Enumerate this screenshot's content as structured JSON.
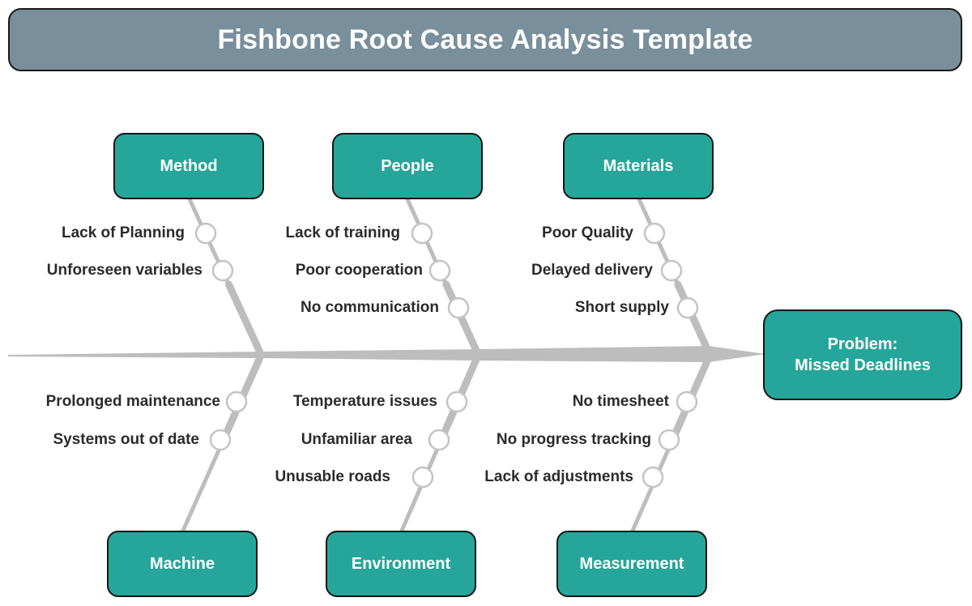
{
  "title": "Fishbone Root Cause Analysis Template",
  "problem": {
    "line1": "Problem:",
    "line2": "Missed Deadlines"
  },
  "colors": {
    "box": "#26a69a",
    "title_bar": "#798f9b",
    "bone": "#bdbdbd",
    "text": "#2b2b2b"
  },
  "categories": [
    {
      "name": "Method",
      "side": "top",
      "causes": [
        "Lack of Planning",
        "Unforeseen variables"
      ]
    },
    {
      "name": "People",
      "side": "top",
      "causes": [
        "Lack of training",
        "Poor cooperation",
        "No communication"
      ]
    },
    {
      "name": "Materials",
      "side": "top",
      "causes": [
        "Poor Quality",
        "Delayed delivery",
        "Short supply"
      ]
    },
    {
      "name": "Machine",
      "side": "bottom",
      "causes": [
        "Prolonged maintenance",
        "Systems out of date"
      ]
    },
    {
      "name": "Environment",
      "side": "bottom",
      "causes": [
        "Temperature issues",
        "Unfamiliar area",
        "Unusable roads"
      ]
    },
    {
      "name": "Measurement",
      "side": "bottom",
      "causes": [
        "No timesheet",
        "No progress tracking",
        "Lack of adjustments"
      ]
    }
  ]
}
